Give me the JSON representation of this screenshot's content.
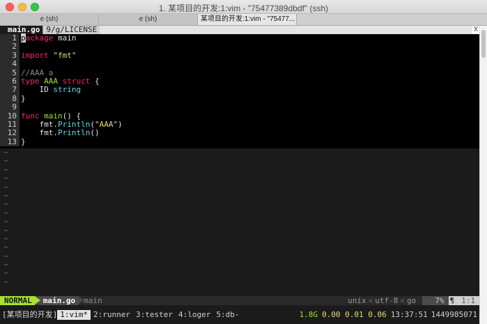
{
  "window": {
    "title": "1. 某项目的开发:1:vim - \"75477389dbdf\" (ssh)",
    "tabs": [
      {
        "label": "e (sh)"
      },
      {
        "label": "e (sh)"
      },
      {
        "label": "某项目的开发:1:vim - \"75477..."
      }
    ]
  },
  "vim": {
    "tabline": {
      "selected": "main.go",
      "other": "9/g/LICENSE",
      "close": "X"
    },
    "buffer": {
      "line_numbers": [
        "1",
        "2",
        "3",
        "4",
        "5",
        "6",
        "7",
        "8",
        "9",
        "10",
        "11",
        "12",
        "13"
      ],
      "lines": {
        "l1_cursor": "p",
        "l1_kw": "ackage",
        "l1_rest": " main",
        "l3_kw": "import",
        "l3_str": "\"fmt\"",
        "l5_comment": "//AAA a",
        "l6_kw": "type",
        "l6_name": "AAA",
        "l6_kw2": "struct",
        "l6_brace": " {",
        "l7_field": "    ID ",
        "l7_type": "string",
        "l8": "}",
        "l10_kw": "func",
        "l10_name": "main",
        "l10_rest": "() {",
        "l11_pkg": "    fmt.",
        "l11_fn": "Println",
        "l11_open": "(",
        "l11_str": "\"AAA\"",
        "l11_close": ")",
        "l12_pkg": "    fmt.",
        "l12_fn": "Println",
        "l12_rest": "()",
        "l13": "}"
      },
      "tilde": "~"
    },
    "statusline": {
      "mode": "NORMAL",
      "filename": "main.go",
      "branch": "main",
      "fileformat": "unix",
      "encoding": "utf-8",
      "filetype": "go",
      "percent": "7%",
      "line_icon": "¶",
      "position": "1:1",
      "separator": "<"
    }
  },
  "tmux": {
    "session": "[某项目的开发]",
    "windows": [
      {
        "label": "1:vim*",
        "active": true
      },
      {
        "label": "2:runner",
        "active": false
      },
      {
        "label": "3:tester",
        "active": false
      },
      {
        "label": "4:loger",
        "active": false
      },
      {
        "label": "5:db-",
        "active": false
      }
    ],
    "memory": "1.8G",
    "load": "0.00 0.01 0.06",
    "time": "13:37:51",
    "epoch": "1449985071"
  },
  "colors": {
    "keyword": "#f9266e",
    "type": "#66d9ef",
    "string": "#e6db74",
    "function": "#a6e22e",
    "mode_bg": "#a6e22e"
  }
}
